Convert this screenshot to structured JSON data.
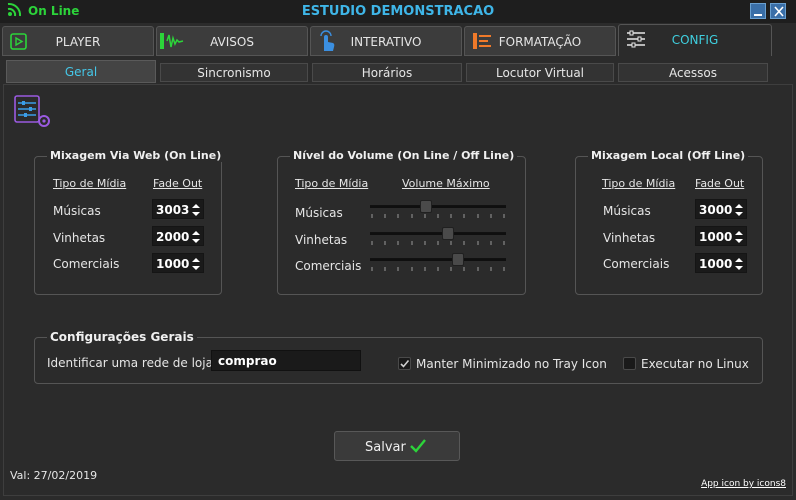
{
  "window": {
    "status": "On Line",
    "title": "ESTUDIO DEMONSTRACAO",
    "accent_color": "#3fb6e8",
    "status_color": "#2cd43a"
  },
  "main_tabs": [
    {
      "label": "PLAYER",
      "icon": "play-icon"
    },
    {
      "label": "AVISOS",
      "icon": "audio-wave-icon"
    },
    {
      "label": "INTERATIVO",
      "icon": "touch-icon"
    },
    {
      "label": "FORMATAÇÃO",
      "icon": "format-lines-icon"
    },
    {
      "label": "CONFIG",
      "icon": "sliders-icon",
      "active": true
    }
  ],
  "sub_tabs": [
    {
      "label": "Geral",
      "active": true
    },
    {
      "label": "Sincronismo"
    },
    {
      "label": "Horários"
    },
    {
      "label": "Locutor Virtual"
    },
    {
      "label": "Acessos"
    }
  ],
  "web_mix": {
    "title": "Mixagem Via Web (On Line)",
    "col_media": "Tipo de Mídia",
    "col_fade": "Fade Out",
    "rows": [
      {
        "label": "Músicas",
        "value": "3003"
      },
      {
        "label": "Vinhetas",
        "value": "2000"
      },
      {
        "label": "Comerciais",
        "value": "1000"
      }
    ]
  },
  "volume": {
    "title": "Nível do Volume (On Line / Off Line)",
    "col_media": "Tipo de Mídia",
    "col_volume": "Volume Máximo",
    "rows": [
      {
        "label": "Músicas",
        "level": 0.4
      },
      {
        "label": "Vinhetas",
        "level": 0.58
      },
      {
        "label": "Comerciais",
        "level": 0.66
      }
    ]
  },
  "local_mix": {
    "title": "Mixagem Local (Off Line)",
    "col_media": "Tipo de Mídia",
    "col_fade": "Fade Out",
    "rows": [
      {
        "label": "Músicas",
        "value": "3000"
      },
      {
        "label": "Vinhetas",
        "value": "1000"
      },
      {
        "label": "Comerciais",
        "value": "1000"
      }
    ]
  },
  "general": {
    "title": "Configurações Gerais",
    "store_label": "Identificar uma rede de lojas:",
    "store_value": "comprao",
    "minimize_label": "Manter Minimizado no Tray Icon",
    "minimize_checked": true,
    "linux_label": "Executar no Linux",
    "linux_checked": false
  },
  "save_label": "Salvar",
  "validity": "Val: 27/02/2019",
  "credit": "App icon by icons8"
}
